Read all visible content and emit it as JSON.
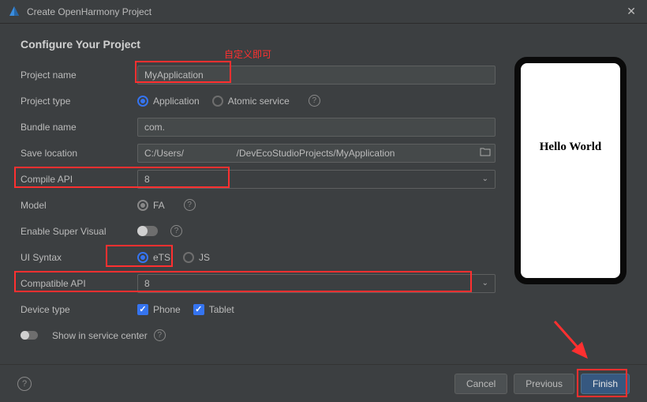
{
  "window": {
    "title": "Create OpenHarmony Project"
  },
  "heading": "Configure Your Project",
  "annotation1": "自定义即可",
  "form": {
    "project_name": {
      "label": "Project name",
      "value": "MyApplication"
    },
    "project_type": {
      "label": "Project type",
      "opt_app": "Application",
      "opt_atomic": "Atomic service"
    },
    "bundle_name": {
      "label": "Bundle name",
      "value": "com."
    },
    "save_location": {
      "label": "Save location",
      "value": "C:/Users/                    /DevEcoStudioProjects/MyApplication"
    },
    "compile_api": {
      "label": "Compile API",
      "value": "8"
    },
    "model": {
      "label": "Model",
      "value": "FA"
    },
    "enable_super_visual": {
      "label": "Enable Super Visual"
    },
    "ui_syntax": {
      "label": "UI Syntax",
      "opt_ets": "eTS",
      "opt_js": "JS"
    },
    "compatible_api": {
      "label": "Compatible API",
      "value": "8"
    },
    "device_type": {
      "label": "Device type",
      "opt_phone": "Phone",
      "opt_tablet": "Tablet"
    },
    "show_in_service_center": "Show in service center"
  },
  "preview": {
    "text": "Hello World"
  },
  "buttons": {
    "cancel": "Cancel",
    "previous": "Previous",
    "finish": "Finish"
  }
}
